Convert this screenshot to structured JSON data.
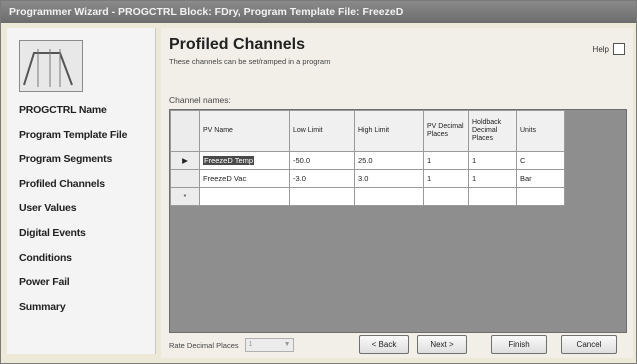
{
  "window": {
    "title": "Programmer Wizard - PROGCTRL Block: FDry, Program Template File: FreezeD"
  },
  "sidebar": {
    "items": [
      {
        "label": "PROGCTRL Name"
      },
      {
        "label": "Program Template File"
      },
      {
        "label": "Program Segments"
      },
      {
        "label": "Profiled Channels"
      },
      {
        "label": "User Values"
      },
      {
        "label": "Digital Events"
      },
      {
        "label": "Conditions"
      },
      {
        "label": "Power Fail"
      },
      {
        "label": "Summary"
      }
    ]
  },
  "page": {
    "title": "Profiled Channels",
    "subtitle": "These channels can be set/ramped in a program",
    "help_label": "Help",
    "channel_label": "Channel names:"
  },
  "table": {
    "columns": [
      "PV Name",
      "Low Limit",
      "High Limit",
      "PV Decimal Places",
      "Holdback Decimal Places",
      "Units"
    ],
    "rows": [
      {
        "marker": "▶",
        "cells": [
          "FreezeD Temp",
          "-50.0",
          "25.0",
          "1",
          "1",
          "C"
        ]
      },
      {
        "marker": "",
        "cells": [
          "FreezeD Vac",
          "-3.0",
          "3.0",
          "1",
          "1",
          "Bar"
        ]
      },
      {
        "marker": "*",
        "cells": [
          "",
          "",
          "",
          "",
          "",
          ""
        ]
      }
    ]
  },
  "footer": {
    "rate_label": "Rate Decimal Places",
    "rate_value": "1",
    "back": "< Back",
    "next": "Next >",
    "finish": "Finish",
    "cancel": "Cancel"
  }
}
